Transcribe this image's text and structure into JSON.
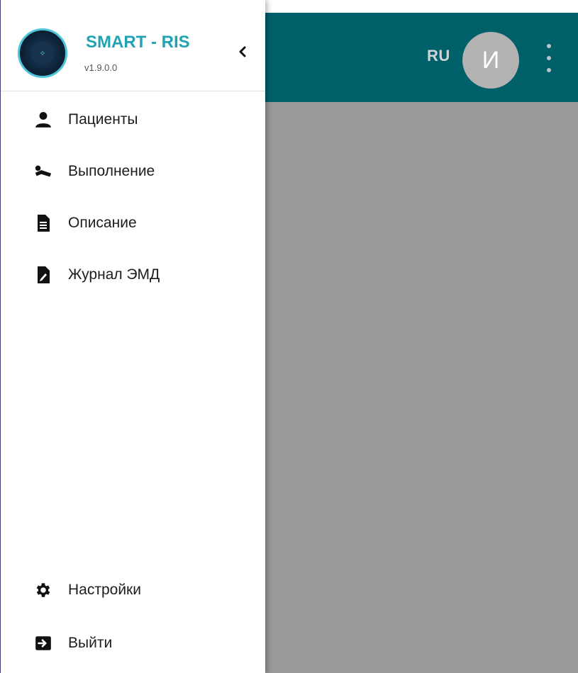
{
  "app": {
    "title": "SMART - RIS",
    "version": "v1.9.0.0",
    "logo_icon": "smart-ris-logo-icon"
  },
  "header": {
    "language": "RU",
    "avatar_initial": "И",
    "accent_color": "#00606a"
  },
  "sidebar": {
    "collapse_icon": "chevron-left-icon",
    "items": [
      {
        "label": "Пациенты",
        "icon": "person-icon"
      },
      {
        "label": "Выполнение",
        "icon": "patient-lying-icon"
      },
      {
        "label": "Описание",
        "icon": "document-icon"
      },
      {
        "label": "Журнал ЭМД",
        "icon": "document-signature-icon"
      }
    ],
    "bottom_items": [
      {
        "label": "Настройки",
        "icon": "gear-icon"
      },
      {
        "label": "Выйти",
        "icon": "logout-icon"
      }
    ]
  },
  "colors": {
    "brand_text": "#21a3b4",
    "topbar": "#00606a",
    "overlay": "#9a9a9a"
  }
}
